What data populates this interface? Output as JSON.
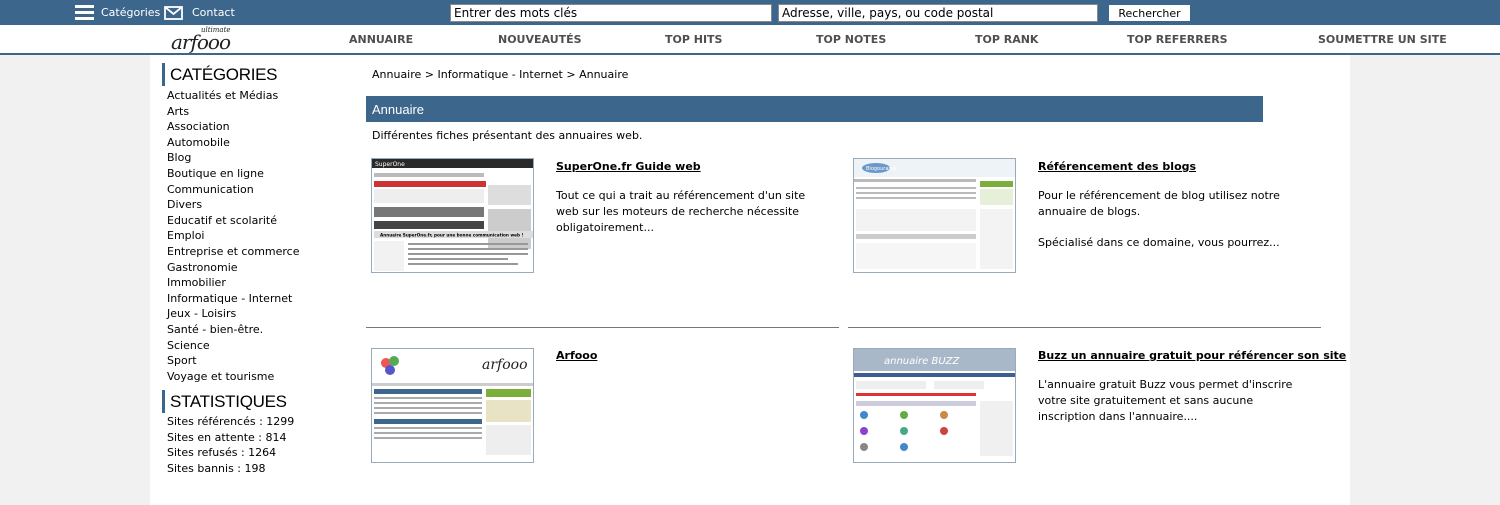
{
  "topbar": {
    "categories_label": "Catégories",
    "contact_label": "Contact",
    "keywords_placeholder": "Entrer des mots clés",
    "address_placeholder": "Adresse, ville, pays, ou code postal",
    "search_button": "Rechercher"
  },
  "logo": {
    "small": "ultimate",
    "big": "arfooo"
  },
  "nav": {
    "items": [
      "ANNUAIRE",
      "NOUVEAUTÉS",
      "TOP HITS",
      "TOP NOTES",
      "TOP RANK",
      "TOP REFERRERS",
      "SOUMETTRE UN SITE"
    ]
  },
  "sidebar": {
    "categories_heading": "CATÉGORIES",
    "categories": [
      "Actualités et Médias",
      "Arts",
      "Association",
      "Automobile",
      "Blog",
      "Boutique en ligne",
      "Communication",
      "Divers",
      "Educatif et scolarité",
      "Emploi",
      "Entreprise et commerce",
      "Gastronomie",
      "Immobilier",
      "Informatique - Internet",
      "Jeux - Loisirs",
      "Santé - bien-être.",
      "Science",
      "Sport",
      "Voyage et tourisme"
    ],
    "stats_heading": "STATISTIQUES",
    "stats": [
      "Sites référencés : 1299",
      "Sites en attente : 814",
      "Sites refusés : 1264",
      "Sites bannis : 198"
    ]
  },
  "breadcrumb": [
    "Annuaire",
    "Informatique - Internet",
    "Annuaire"
  ],
  "breadcrumb_sep": " > ",
  "section": {
    "title": "Annuaire",
    "description": "Différentes fiches présentant des annuaires web."
  },
  "entries": [
    {
      "title": "SuperOne.fr Guide web",
      "paragraphs": [
        "Tout ce qui a trait au référencement d'un site web sur les moteurs de recherche nécessite obligatoirement..."
      ],
      "thumb_logo": "SuperOne",
      "thumb_banner": "Annuaire SuperOne.fr, pour une bonne communication web !"
    },
    {
      "title": "Référencement des blogs",
      "paragraphs": [
        "Pour le référencement de blog utilisez notre annuaire de blogs.",
        "Spécialisé dans ce domaine, vous pourrez..."
      ],
      "thumb_logo": "Blogourama"
    },
    {
      "title": "Arfooo",
      "paragraphs": [
        ""
      ],
      "thumb_logo": "arfooo"
    },
    {
      "title": "Buzz un annuaire gratuit pour référencer son site",
      "paragraphs": [
        "L'annuaire gratuit Buzz vous permet d'inscrire votre site gratuitement et sans aucune inscription dans l'annuaire...."
      ],
      "thumb_logo": "annuaire BUZZ"
    }
  ],
  "colors": {
    "accent": "#3d668c",
    "background": "#f1f1f1"
  }
}
